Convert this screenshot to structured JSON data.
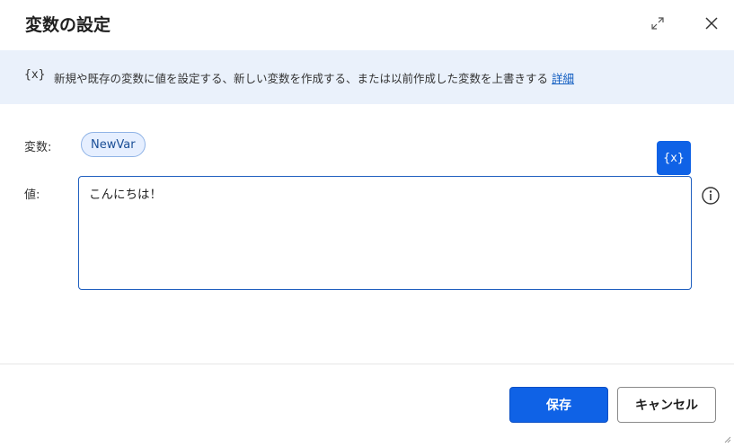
{
  "dialog": {
    "title": "変数の設定",
    "expand_icon": "expand-icon",
    "close_icon": "close-icon"
  },
  "banner": {
    "icon_text": "{x}",
    "text": "新規や既存の変数に値を設定する、新しい変数を作成する、または以前作成した変数を上書きする",
    "link": "詳細",
    "background": "#eaf1fb"
  },
  "form": {
    "variable_label": "変数:",
    "variable_name": "NewVar",
    "value_label": "値:",
    "value_text": "こんにちは！",
    "fx_button_text": "{x}",
    "info_icon": "info-icon"
  },
  "footer": {
    "save_label": "保存",
    "cancel_label": "キャンセル"
  },
  "colors": {
    "accent": "#0f62e6",
    "chip_bg": "#e6efff",
    "chip_border": "#8fb3e6"
  }
}
